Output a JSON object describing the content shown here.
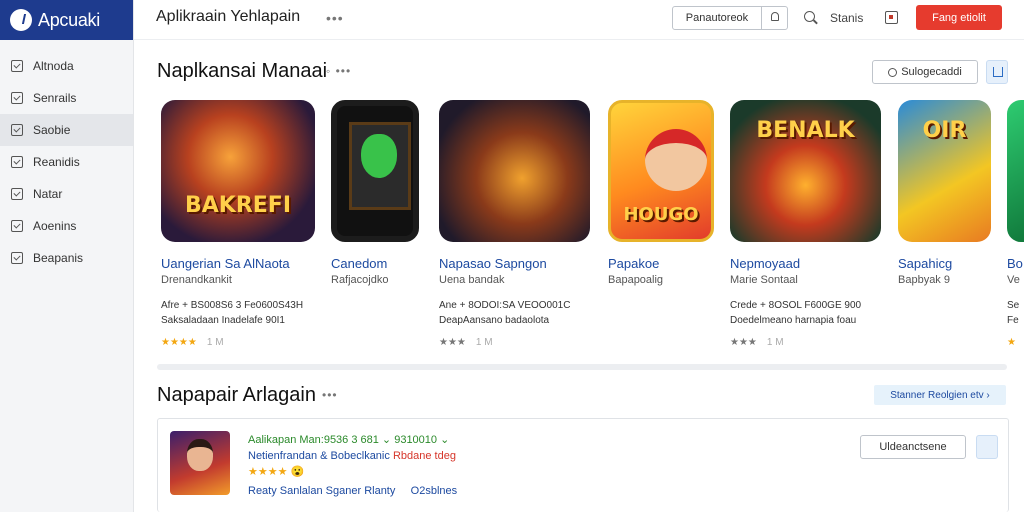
{
  "app": {
    "brand": "Apcuaki",
    "title": "Aplikraain Yehlapain",
    "title_more": "•••"
  },
  "topbar": {
    "search_label": "Panautoreok",
    "link": "Stanis",
    "cta": "Fang etiolit"
  },
  "sidebar": {
    "items": [
      {
        "label": "Altnoda",
        "icon": "checkbox-icon"
      },
      {
        "label": "Senrails",
        "icon": "checkbox-icon"
      },
      {
        "label": "Saobie",
        "icon": "list-icon",
        "active": true
      },
      {
        "label": "Reanidis",
        "icon": "checkbox-icon"
      },
      {
        "label": "Natar",
        "icon": "checkbox-icon"
      },
      {
        "label": "Aoenins",
        "icon": "checkbox-icon"
      },
      {
        "label": "Beapanis",
        "icon": "checkbox-icon"
      }
    ]
  },
  "section1": {
    "title": "Naplkansai Manaai",
    "meta": "◦ •••",
    "button": "Sulogecaddi",
    "cards": [
      {
        "title": "Uangerian Sa AlNaota",
        "sub": "Drenandkankit",
        "desc1": "Afre + BS008S6 3 Fe0600S43H",
        "desc2": "Saksaladaan Inadelafe 90I1",
        "rating": 4,
        "count": "1 M",
        "gold": true,
        "logo": "BAKREFI"
      },
      {
        "title": "Canedom",
        "sub": "Rafjacojdko",
        "desc1": "",
        "desc2": "",
        "rating": 0,
        "count": "",
        "gold": false,
        "logo": ""
      },
      {
        "title": "Napasao Sapngon",
        "sub": "Uena bandak",
        "desc1": "Ane + 8ODOI:SA VEOO001C",
        "desc2": "DeapAansano badaolota",
        "rating": 3,
        "count": "1 M",
        "gold": false,
        "logo": ""
      },
      {
        "title": "Papakoe",
        "sub": "Bapapoalig",
        "desc1": "",
        "desc2": "",
        "rating": 0,
        "count": "",
        "gold": false,
        "logo": "HOUGO"
      },
      {
        "title": "Nepmoyaad",
        "sub": "Marie Sontaal",
        "desc1": "Crede + 8OSOL F600GE 900",
        "desc2": "Doedelmeano harnapia foau",
        "rating": 3,
        "count": "1 M",
        "gold": false,
        "logo": "BENALK"
      },
      {
        "title": "Sapahicg",
        "sub": "Bapbyak 9",
        "desc1": "",
        "desc2": "",
        "rating": 0,
        "count": "",
        "gold": false,
        "logo": "OIR"
      },
      {
        "title": "Bo",
        "sub": "Ve",
        "desc1": "Se",
        "desc2": "Fe",
        "rating": 1,
        "count": "",
        "gold": true,
        "logo": ""
      }
    ]
  },
  "section2": {
    "title": "Napapair Arlagain",
    "meta": "•••",
    "see_all": "Stanner Reolgien etv ›",
    "row": {
      "title": "Aalikapan Man:9536 3 681 ⌄ 9310010 ⌄",
      "sub": "Netienfrandan & Bobeclkanic",
      "sub_warn": "Rbdane tdeg",
      "stars": "★★★★ 😮",
      "foot_a": "Reaty Sanlalan Sganer Rlanty",
      "foot_b": "O2sblnes",
      "button": "Uldeanctsene"
    }
  }
}
